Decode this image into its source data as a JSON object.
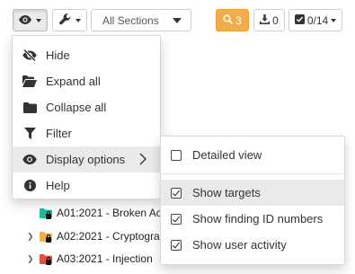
{
  "toolbar": {
    "sections_label": "All Sections",
    "search_count": "3",
    "download_count": "0",
    "check_label": "0/14"
  },
  "tree": [
    {
      "label": "A01:2021 - Broken Ac",
      "folder_color": "#1abc9c"
    },
    {
      "label": "A02:2021 - Cryptogra",
      "folder_color": "#f0ad4e"
    },
    {
      "label": "A03:2021 - Injection",
      "folder_color": "#e74c3c"
    }
  ],
  "menu": {
    "items": [
      {
        "label": "Hide",
        "icon": "eye-slash-icon"
      },
      {
        "label": "Expand all",
        "icon": "folder-open-icon"
      },
      {
        "label": "Collapse all",
        "icon": "folder-icon"
      },
      {
        "label": "Filter",
        "icon": "filter-icon"
      },
      {
        "label": "Display options",
        "icon": "eye-icon"
      },
      {
        "label": "Help",
        "icon": "info-icon"
      }
    ]
  },
  "submenu": {
    "items": [
      {
        "label": "Detailed view",
        "checked": false
      },
      {
        "label": "Show targets",
        "checked": true
      },
      {
        "label": "Show finding ID numbers",
        "checked": true
      },
      {
        "label": "Show user activity",
        "checked": true
      }
    ]
  },
  "colors": {
    "accent": "#f0ad4e",
    "highlight": "#eaeaea"
  }
}
